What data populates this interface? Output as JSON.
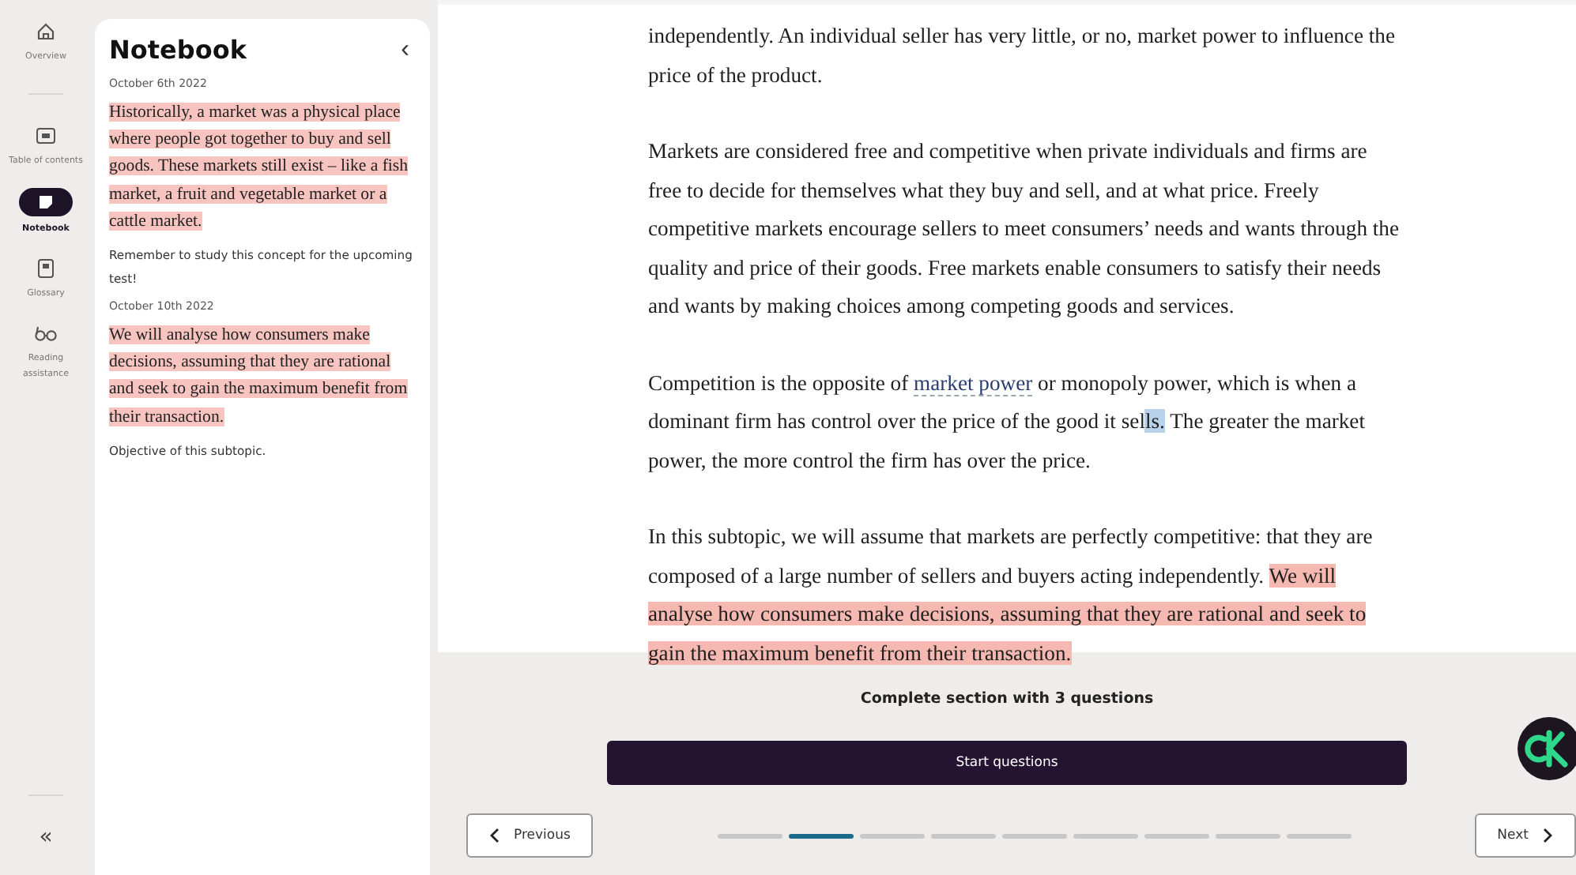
{
  "rail": {
    "items": [
      {
        "kind": "home",
        "label": "Overview",
        "selected": false
      },
      {
        "kind": "toc",
        "label": "Table of contents",
        "selected": false
      },
      {
        "kind": "note",
        "label": "Notebook",
        "selected": true
      },
      {
        "kind": "book",
        "label": "Glossary",
        "selected": false
      },
      {
        "kind": "glasses",
        "label": "Reading assistance",
        "selected": false
      }
    ],
    "collapse": "«"
  },
  "notebook": {
    "title": "Notebook",
    "close": "‹",
    "entries": [
      {
        "kind": "date",
        "text": "October 6th 2022"
      },
      {
        "kind": "highlight",
        "text": " Historically, a market was a physical place where people got together to buy and sell goods. These markets still exist – like a fish market, a fruit and vegetable market or a cattle market."
      },
      {
        "kind": "note",
        "text": "Remember to study this concept for the upcoming test!"
      },
      {
        "kind": "date",
        "text": "October 10th 2022"
      },
      {
        "kind": "highlight",
        "text": " We will analyse how consumers make decisions, assuming that they are rational and seek to gain the maximum benefit from their transaction."
      },
      {
        "kind": "note",
        "text": "Objective of this subtopic."
      }
    ]
  },
  "article": {
    "paragraphs": [
      [
        {
          "kind": "text",
          "text": "independently. An individual seller has very little, or no, market power to influence the price of the product."
        }
      ],
      [
        {
          "kind": "text",
          "text": "Markets are considered free and competitive when private individuals and firms are free to decide for themselves what they buy and sell, and at what price. Freely competitive markets encourage sellers to meet consumers’ needs and wants through the quality and price of their goods. Free markets enable consumers to satisfy their needs and wants by making choices among competing goods and services."
        }
      ],
      [
        {
          "kind": "text",
          "text": "Competition is the opposite of "
        },
        {
          "kind": "link",
          "text": "market power"
        },
        {
          "kind": "text",
          "text": " or monopoly power, which is when a dominant firm has control over the price of the good it se"
        },
        {
          "kind": "text",
          "text": "l"
        },
        {
          "kind": "selection",
          "text": "ls."
        },
        {
          "kind": "text",
          "text": " The greater the market power, the more control the firm has over the price."
        }
      ],
      [
        {
          "kind": "text",
          "text": "In this subtopic, we will assume that markets are perfectly competitive: that they are composed of a large number of sellers and buyers acting independently. "
        },
        {
          "kind": "highlight",
          "text": "We will analyse how consumers make decisions, assuming that they are rational and seek to gain the maximum benefit from their transaction."
        }
      ]
    ]
  },
  "footer": {
    "prompt": "Complete section with 3 questions",
    "start": "Start questions",
    "previous": "Previous",
    "next": "Next",
    "progress": [
      {
        "selected": false
      },
      {
        "selected": true
      },
      {
        "selected": false
      },
      {
        "selected": false
      },
      {
        "selected": false
      },
      {
        "selected": false
      },
      {
        "selected": false
      },
      {
        "selected": false
      },
      {
        "selected": false
      }
    ]
  }
}
